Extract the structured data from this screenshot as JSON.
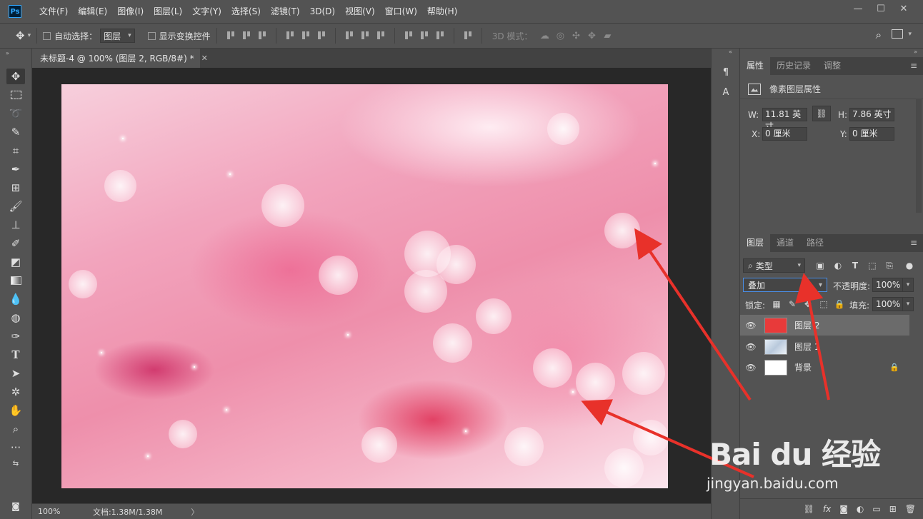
{
  "app": {
    "logo": "Ps"
  },
  "menu": [
    "文件(F)",
    "编辑(E)",
    "图像(I)",
    "图层(L)",
    "文字(Y)",
    "选择(S)",
    "滤镜(T)",
    "3D(D)",
    "视图(V)",
    "窗口(W)",
    "帮助(H)"
  ],
  "window_controls": {
    "minimize": "—",
    "maximize": "☐",
    "close": "✕"
  },
  "options": {
    "auto_select_label": "自动选择：",
    "auto_select_value": "图层",
    "show_transform_label": "显示变换控件",
    "mode_3d_label": "3D 模式："
  },
  "document": {
    "tab_title": "未标题-4 @ 100% (图层 2, RGB/8#) *",
    "close": "✕"
  },
  "status": {
    "zoom": "100%",
    "doc_info": "文档:1.38M/1.38M",
    "arrow": "〉"
  },
  "properties_panel": {
    "tabs": [
      "属性",
      "历史记录",
      "调整"
    ],
    "header": "像素图层属性",
    "w_label": "W:",
    "w_value": "11.81 英寸",
    "h_label": "H:",
    "h_value": "7.86 英寸",
    "x_label": "X:",
    "x_value": "0 厘米",
    "y_label": "Y:",
    "y_value": "0 厘米"
  },
  "layers_panel": {
    "tabs": [
      "图层",
      "通道",
      "路径"
    ],
    "filter_kind": "类型",
    "blend_mode": "叠加",
    "opacity_label": "不透明度:",
    "opacity_value": "100%",
    "lock_label": "锁定:",
    "fill_label": "填充:",
    "fill_value": "100%",
    "layers": [
      {
        "name": "图层 2",
        "selected": true,
        "thumb_color": "#e83a3a"
      },
      {
        "name": "图层 1",
        "selected": false,
        "thumb_color": "#cfd9e6"
      },
      {
        "name": "背景",
        "selected": false,
        "thumb_color": "#ffffff",
        "locked": true
      }
    ]
  },
  "colors": {
    "foreground": "#e23b3b",
    "background": "#ffffff",
    "annotation_arrow": "#e8312a"
  },
  "watermark": {
    "main": "Bai du 经验",
    "sub": "jingyan.baidu.com"
  }
}
